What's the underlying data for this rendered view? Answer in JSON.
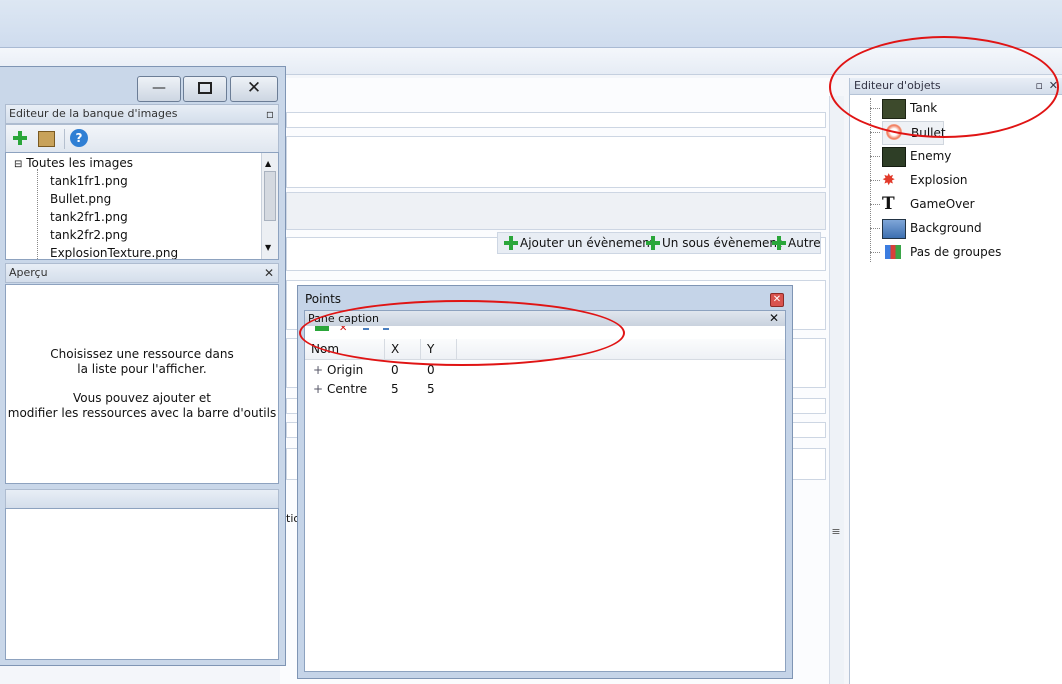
{
  "image_bank": {
    "title": "Editeur de la banque d'images",
    "toolbar_icons": [
      "add-icon",
      "package-icon",
      "help-icon"
    ],
    "root_label": "Toutes les images",
    "items": [
      "tank1fr1.png",
      "Bullet.png",
      "tank2fr1.png",
      "tank2fr2.png",
      "ExplosionTexture.png"
    ],
    "window_controls": [
      "minimize-icon",
      "restore-icon",
      "close-icon"
    ]
  },
  "preview": {
    "title": "Aperçu",
    "line1": "Choisissez une ressource dans",
    "line2": "la liste pour l'afficher.",
    "line3": "Vous pouvez ajouter et",
    "line4": "modifier les ressources avec la barre d'outils"
  },
  "events": {
    "add_event": "Ajouter un évènement",
    "add_sub_event": "Un sous évènement",
    "other": "Autre",
    "clipped_text": "tio"
  },
  "points": {
    "title": "Points",
    "pane_caption": "Pane caption",
    "columns": [
      "Nom",
      "X",
      "Y"
    ],
    "rows": [
      {
        "name": "Origin",
        "x": "0",
        "y": "0"
      },
      {
        "name": "Centre",
        "x": "5",
        "y": "5"
      }
    ]
  },
  "object_editor": {
    "title": "Editeur d'objets",
    "items": [
      {
        "label": "Tank",
        "icon": "tank-icon"
      },
      {
        "label": "Bullet",
        "icon": "bullet-icon"
      },
      {
        "label": "Enemy",
        "icon": "enemy-tank-icon"
      },
      {
        "label": "Explosion",
        "icon": "explosion-icon"
      },
      {
        "label": "GameOver",
        "icon": "text-object-icon"
      },
      {
        "label": "Background",
        "icon": "background-icon"
      },
      {
        "label": "Pas de groupes",
        "icon": "groups-icon"
      }
    ]
  },
  "colors": {
    "annotation": "#e01414",
    "accent_green": "#2aa63a"
  }
}
